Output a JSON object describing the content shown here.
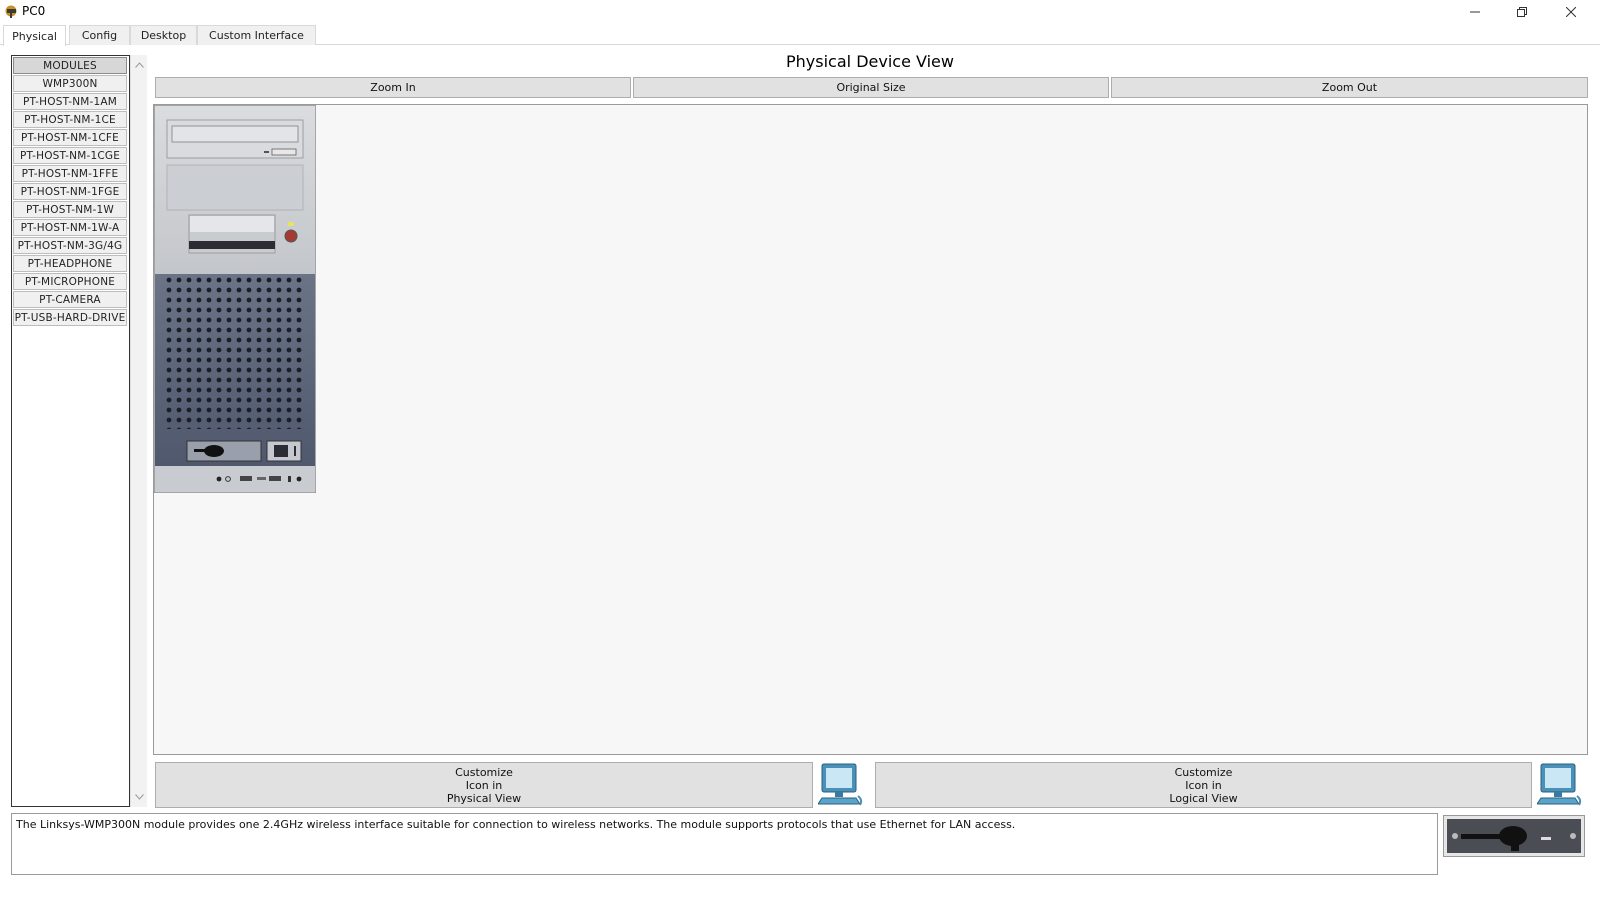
{
  "window": {
    "title": "PC0",
    "app_icon": "packet-tracer-icon",
    "controls": [
      "minimize-icon",
      "restore-icon",
      "close-icon"
    ]
  },
  "tabs": [
    {
      "label": "Physical",
      "active": true
    },
    {
      "label": "Config",
      "active": false
    },
    {
      "label": "Desktop",
      "active": false
    },
    {
      "label": "Custom Interface",
      "active": false
    }
  ],
  "modules": {
    "header": "MODULES",
    "items": [
      "WMP300N",
      "PT-HOST-NM-1AM",
      "PT-HOST-NM-1CE",
      "PT-HOST-NM-1CFE",
      "PT-HOST-NM-1CGE",
      "PT-HOST-NM-1FFE",
      "PT-HOST-NM-1FGE",
      "PT-HOST-NM-1W",
      "PT-HOST-NM-1W-A",
      "PT-HOST-NM-3G/4G",
      "PT-HEADPHONE",
      "PT-MICROPHONE",
      "PT-CAMERA",
      "PT-USB-HARD-DRIVE"
    ]
  },
  "main": {
    "title": "Physical Device View",
    "zoom_in": "Zoom In",
    "original_size": "Original Size",
    "zoom_out": "Zoom Out"
  },
  "customize": {
    "physical": {
      "line1": "Customize",
      "line2": "Icon in",
      "line3": "Physical View"
    },
    "logical": {
      "line1": "Customize",
      "line2": "Icon in",
      "line3": "Logical View"
    }
  },
  "description": "The Linksys-WMP300N module provides one 2.4GHz wireless interface suitable for connection to wireless networks. The module supports protocols that use Ethernet for LAN access.",
  "colors": {
    "tower_top": "#cfd2d6",
    "tower_bottom": "#5a6478",
    "button_face": "#e1e1e1"
  }
}
